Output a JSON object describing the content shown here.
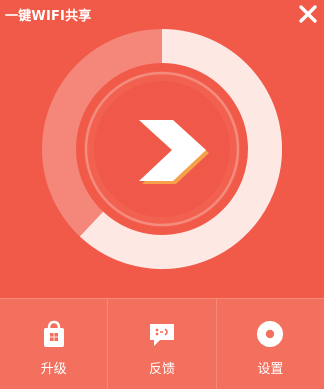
{
  "window": {
    "title": "一键WIFI共享"
  },
  "dial": {
    "progress": 0.62,
    "action": "start-share"
  },
  "bottom_bar": {
    "upgrade_label": "升级",
    "feedback_label": "反馈",
    "settings_label": "设置"
  },
  "colors": {
    "background": "#f15a48",
    "bottom_bar": "#f2705d",
    "ring_fill": "#fde9e6",
    "ring_track": "#f59a8d",
    "arrow": "#ffffff"
  },
  "icons": {
    "close": "close-icon",
    "play": "play-arrow-icon",
    "upgrade": "store-bag-icon",
    "feedback": "chat-bubble-icon",
    "settings": "gear-icon"
  }
}
